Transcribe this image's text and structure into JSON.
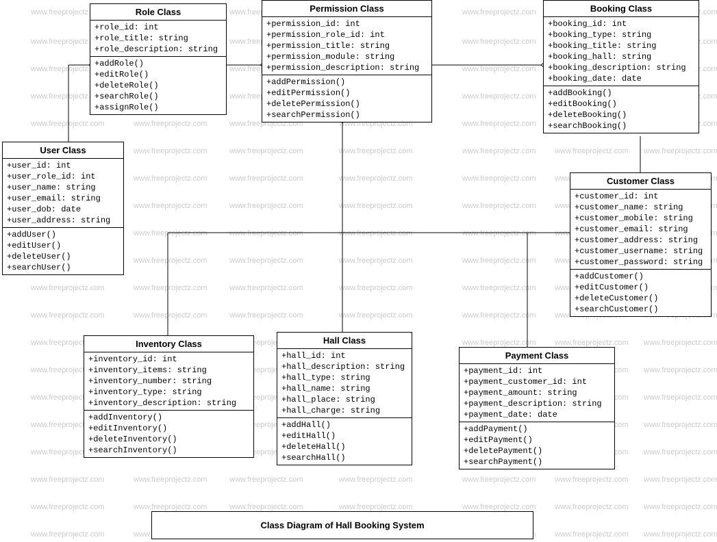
{
  "watermarkText": "www.freeprojectz.com",
  "title": "Class Diagram of Hall Booking System",
  "classes": {
    "role": {
      "name": "Role Class",
      "attrs": [
        "+role_id: int",
        "+role_title: string",
        "+role_description: string"
      ],
      "methods": [
        "+addRole()",
        "+editRole()",
        "+deleteRole()",
        "+searchRole()",
        "+assignRole()"
      ]
    },
    "permission": {
      "name": "Permission Class",
      "attrs": [
        "+permission_id: int",
        "+permission_role_id: int",
        "+permission_title: string",
        "+permission_module: string",
        "+permission_description: string"
      ],
      "methods": [
        "+addPermission()",
        "+editPermission()",
        "+deletePermission()",
        "+searchPermission()"
      ]
    },
    "booking": {
      "name": "Booking Class",
      "attrs": [
        "+booking_id: int",
        "+booking_type: string",
        "+booking_title: string",
        "+booking_hall: string",
        "+booking_description: string",
        "+booking_date: date"
      ],
      "methods": [
        "+addBooking()",
        "+editBooking()",
        "+deleteBooking()",
        "+searchBooking()"
      ]
    },
    "user": {
      "name": "User Class",
      "attrs": [
        "+user_id: int",
        "+user_role_id: int",
        "+user_name: string",
        "+user_email: string",
        "+user_dob: date",
        "+user_address: string"
      ],
      "methods": [
        "+addUser()",
        "+editUser()",
        "+deleteUser()",
        "+searchUser()"
      ]
    },
    "customer": {
      "name": "Customer Class",
      "attrs": [
        "+customer_id: int",
        "+customer_name: string",
        "+customer_mobile: string",
        "+customer_email: string",
        "+customer_address: string",
        "+customer_username: string",
        "+customer_password: string"
      ],
      "methods": [
        "+addCustomer()",
        "+editCustomer()",
        "+deleteCustomer()",
        "+searchCustomer()"
      ]
    },
    "inventory": {
      "name": "Inventory Class",
      "attrs": [
        "+inventory_id: int",
        "+inventory_items: string",
        "+inventory_number: string",
        "+inventory_type: string",
        "+inventory_description: string"
      ],
      "methods": [
        "+addInventory()",
        "+editInventory()",
        "+deleteInventory()",
        "+searchInventory()"
      ]
    },
    "hall": {
      "name": "Hall Class",
      "attrs": [
        "+hall_id: int",
        "+hall_description: string",
        "+hall_type: string",
        "+hall_name: string",
        "+hall_place: string",
        "+hall_charge: string"
      ],
      "methods": [
        "+addHall()",
        "+editHall()",
        "+deleteHall()",
        "+searchHall()"
      ]
    },
    "payment": {
      "name": "Payment Class",
      "attrs": [
        "+payment_id: int",
        "+payment_customer_id: int",
        "+payment_amount: string",
        "+payment_description: string",
        "+payment_date: date"
      ],
      "methods": [
        "+addPayment()",
        "+editPayment()",
        "+deletePayment()",
        "+searchPayment()"
      ]
    }
  }
}
